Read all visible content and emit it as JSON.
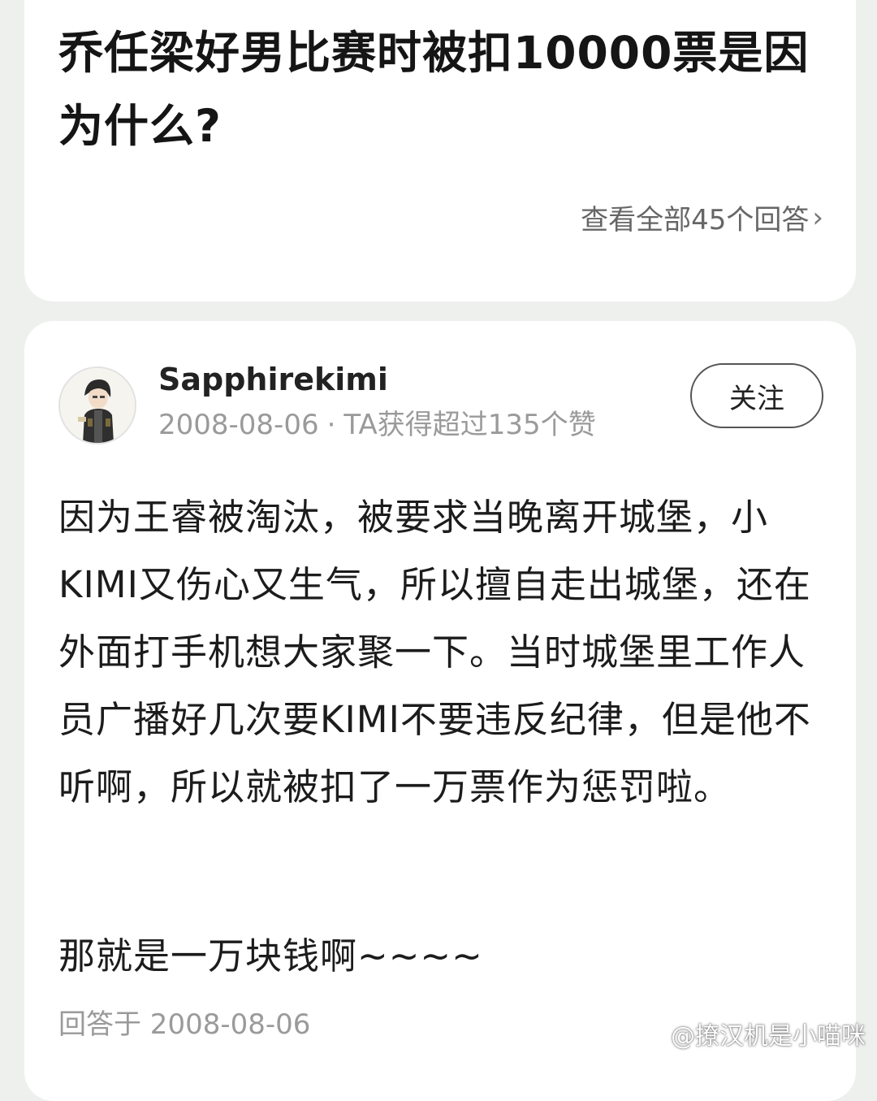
{
  "question": {
    "title": "乔任梁好男比赛时被扣10000票是因为什么?",
    "view_all_label": "查看全部45个回答",
    "view_all_chevron": "›"
  },
  "answer": {
    "username": "Sapphirekimi",
    "date": "2008-08-06",
    "meta_separator": "·",
    "likes_text": "TA获得超过135个赞",
    "follow_label": "关注",
    "body": "因为王睿被淘汰，被要求当晚离开城堡，小KIMI又伤心又生气，所以擅自走出城堡，还在外面打手机想大家聚一下。当时城堡里工作人员广播好几次要KIMI不要违反纪律，但是他不听啊，所以就被扣了一万票作为惩罚啦。",
    "tail": "那就是一万块钱啊~~~~",
    "answered_at": "回答于 2008-08-06"
  },
  "watermark": {
    "text": "@撩汉机是小喵咪",
    "icon": "weibo-logo-icon"
  },
  "colors": {
    "background": "#eef0ee",
    "card": "#ffffff",
    "primary_text": "#1c1c1c",
    "secondary_text": "#9a9a9a"
  }
}
